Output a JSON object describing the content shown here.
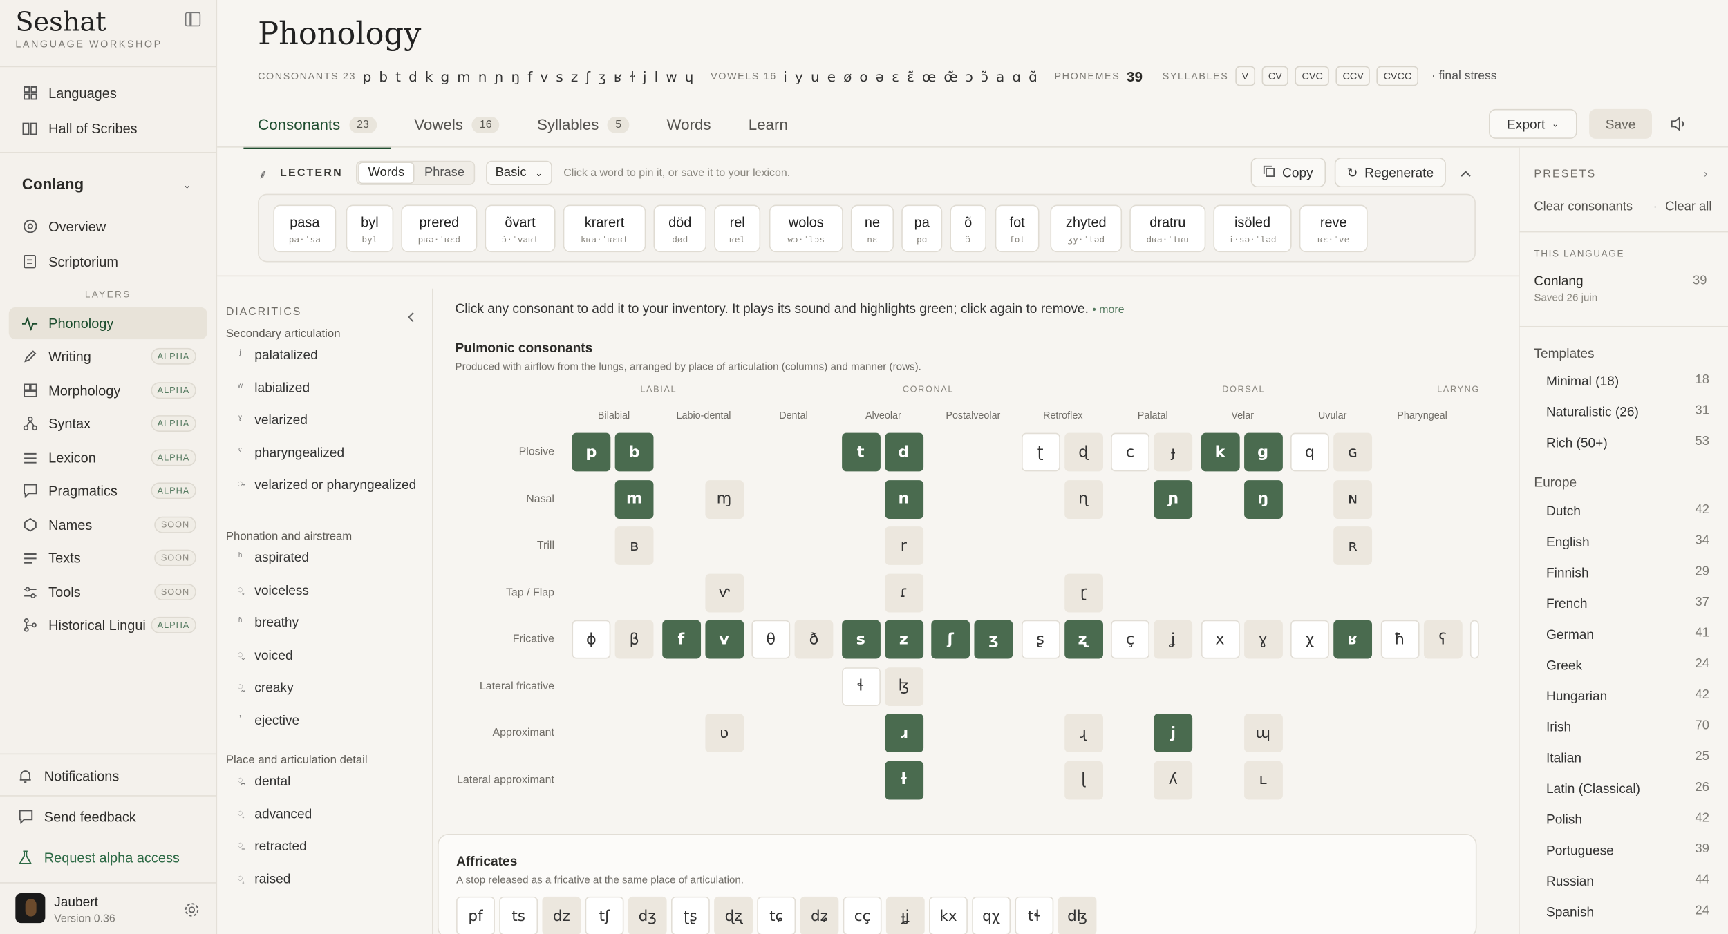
{
  "brand": {
    "name": "Seshat",
    "sub": "LANGUAGE WORKSHOP"
  },
  "nav": {
    "languages": "Languages",
    "hall": "Hall of Scribes",
    "conlang": "Conlang",
    "overview": "Overview",
    "scriptorium": "Scriptorium",
    "layers": "LAYERS",
    "items": [
      {
        "label": "Phonology",
        "badge": ""
      },
      {
        "label": "Writing",
        "badge": "ALPHA"
      },
      {
        "label": "Morphology",
        "badge": "ALPHA"
      },
      {
        "label": "Syntax",
        "badge": "ALPHA"
      },
      {
        "label": "Lexicon",
        "badge": "ALPHA"
      },
      {
        "label": "Pragmatics",
        "badge": "ALPHA"
      },
      {
        "label": "Names",
        "badge": "SOON"
      },
      {
        "label": "Texts",
        "badge": "SOON"
      },
      {
        "label": "Tools",
        "badge": "SOON"
      },
      {
        "label": "Historical Lingui:",
        "badge": "ALPHA"
      }
    ],
    "notifications": "Notifications",
    "feedback": "Send feedback",
    "alpha": "Request alpha access",
    "user": "Jaubert",
    "version": "Version 0.36"
  },
  "header": {
    "title": "Phonology",
    "consonants_label": "CONSONANTS 23",
    "consonants": "p b t d k g m n ɲ ŋ f v s z ʃ ʒ ʁ ɫ j l w ɥ",
    "vowels_label": "VOWELS 16",
    "vowels": "i y u e ø o ə ɛ ɛ̃ œ œ̃ ɔ ɔ̃ a ɑ ɑ̃",
    "phonemes_label": "PHONEMES",
    "phonemes": "39",
    "syllables_label": "SYLLABLES",
    "syllables": [
      "V",
      "CV",
      "CVC",
      "CCV",
      "CVCC"
    ],
    "stress": "· final stress"
  },
  "tabs": [
    {
      "label": "Consonants",
      "count": "23"
    },
    {
      "label": "Vowels",
      "count": "16"
    },
    {
      "label": "Syllables",
      "count": "5"
    },
    {
      "label": "Words",
      "count": ""
    },
    {
      "label": "Learn",
      "count": ""
    }
  ],
  "toolbar": {
    "export": "Export",
    "save": "Save"
  },
  "lectern": {
    "label": "LECTERN",
    "mode_words": "Words",
    "mode_phrase": "Phrase",
    "select": "Basic",
    "hint": "Click a word to pin it, or save it to your lexicon.",
    "copy": "Copy",
    "regenerate": "Regenerate",
    "words": [
      {
        "w": "pasa",
        "ipa": "pa·ˈsa"
      },
      {
        "w": "byl",
        "ipa": "byl"
      },
      {
        "w": "prered",
        "ipa": "pʁə·ˈʁɛd"
      },
      {
        "w": "õvart",
        "ipa": "ɔ̃·ˈvaʁt"
      },
      {
        "w": "krarert",
        "ipa": "kʁa·ˈʁɛʁt"
      },
      {
        "w": "död",
        "ipa": "død"
      },
      {
        "w": "rel",
        "ipa": "ʁel"
      },
      {
        "w": "wolos",
        "ipa": "wɔ·ˈlɔs"
      },
      {
        "w": "ne",
        "ipa": "nɛ"
      },
      {
        "w": "pa",
        "ipa": "pɑ"
      },
      {
        "w": "õ",
        "ipa": "ɔ̃"
      },
      {
        "w": "fot",
        "ipa": "fot"
      },
      {
        "w": "zhyted",
        "ipa": "ʒy·ˈtəd"
      },
      {
        "w": "dratru",
        "ipa": "dʁa·ˈtʁu"
      },
      {
        "w": "isöled",
        "ipa": "i·sə·ˈləd"
      },
      {
        "w": "reve",
        "ipa": "ʁɛ·ˈve"
      }
    ]
  },
  "diacritics": {
    "title": "DIACRITICS",
    "groups": [
      {
        "name": "Secondary articulation",
        "items": [
          {
            "m": "ʲ",
            "l": "palatalized"
          },
          {
            "m": "ʷ",
            "l": "labialized"
          },
          {
            "m": "ˠ",
            "l": "velarized"
          },
          {
            "m": "ˤ",
            "l": "pharyngealized"
          },
          {
            "m": "◌̴",
            "l": "velarized or pharyngealized"
          }
        ]
      },
      {
        "name": "Phonation and airstream",
        "items": [
          {
            "m": "ʰ",
            "l": "aspirated"
          },
          {
            "m": "◌̥",
            "l": "voiceless"
          },
          {
            "m": "ʱ",
            "l": "breathy"
          },
          {
            "m": "◌̬",
            "l": "voiced"
          },
          {
            "m": "◌̰",
            "l": "creaky"
          },
          {
            "m": "ʼ",
            "l": "ejective"
          }
        ]
      },
      {
        "name": "Place and articulation detail",
        "items": [
          {
            "m": "◌̪",
            "l": "dental"
          },
          {
            "m": "◌̟",
            "l": "advanced"
          },
          {
            "m": "◌̠",
            "l": "retracted"
          },
          {
            "m": "◌̝",
            "l": "raised"
          }
        ]
      }
    ]
  },
  "chart": {
    "note": "Click any consonant to add it to your inventory. It plays its sound and highlights green; click again to remove.",
    "more": "• more",
    "title": "Pulmonic consonants",
    "sub": "Produced with airflow from the lungs, arranged by place of articulation (columns) and manner (rows).",
    "groups": [
      "LABIAL",
      "CORONAL",
      "DORSAL",
      "LARYNG"
    ],
    "columns": [
      "Bilabial",
      "Labio-dental",
      "Dental",
      "Alveolar",
      "Postalveolar",
      "Retroflex",
      "Palatal",
      "Velar",
      "Uvular",
      "Pharyngeal"
    ],
    "rows": [
      "Plosive",
      "Nasal",
      "Trill",
      "Tap / Flap",
      "Fricative",
      "Lateral fricative",
      "Approximant",
      "Lateral approximant"
    ]
  },
  "cells": [
    {
      "s": "p",
      "r": 0,
      "c": 0,
      "v": 0,
      "st": "on"
    },
    {
      "s": "b",
      "r": 0,
      "c": 0,
      "v": 1,
      "st": "on"
    },
    {
      "s": "t",
      "r": 0,
      "c": 3,
      "v": 0,
      "st": "on"
    },
    {
      "s": "d",
      "r": 0,
      "c": 3,
      "v": 1,
      "st": "on"
    },
    {
      "s": "ʈ",
      "r": 0,
      "c": 5,
      "v": 0,
      "st": "off"
    },
    {
      "s": "ɖ",
      "r": 0,
      "c": 5,
      "v": 1,
      "st": "tint"
    },
    {
      "s": "c",
      "r": 0,
      "c": 6,
      "v": 0,
      "st": "off"
    },
    {
      "s": "ɟ",
      "r": 0,
      "c": 6,
      "v": 1,
      "st": "tint"
    },
    {
      "s": "k",
      "r": 0,
      "c": 7,
      "v": 0,
      "st": "on"
    },
    {
      "s": "g",
      "r": 0,
      "c": 7,
      "v": 1,
      "st": "on"
    },
    {
      "s": "q",
      "r": 0,
      "c": 8,
      "v": 0,
      "st": "off"
    },
    {
      "s": "ɢ",
      "r": 0,
      "c": 8,
      "v": 1,
      "st": "tint"
    },
    {
      "s": "m",
      "r": 1,
      "c": 0,
      "v": 1,
      "st": "on"
    },
    {
      "s": "ɱ",
      "r": 1,
      "c": 1,
      "v": 1,
      "st": "tint"
    },
    {
      "s": "n",
      "r": 1,
      "c": 3,
      "v": 1,
      "st": "on"
    },
    {
      "s": "ɳ",
      "r": 1,
      "c": 5,
      "v": 1,
      "st": "tint"
    },
    {
      "s": "ɲ",
      "r": 1,
      "c": 6,
      "v": 1,
      "st": "on"
    },
    {
      "s": "ŋ",
      "r": 1,
      "c": 7,
      "v": 1,
      "st": "on"
    },
    {
      "s": "ɴ",
      "r": 1,
      "c": 8,
      "v": 1,
      "st": "tint"
    },
    {
      "s": "ʙ",
      "r": 2,
      "c": 0,
      "v": 1,
      "st": "tint"
    },
    {
      "s": "r",
      "r": 2,
      "c": 3,
      "v": 1,
      "st": "tint"
    },
    {
      "s": "ʀ",
      "r": 2,
      "c": 8,
      "v": 1,
      "st": "tint"
    },
    {
      "s": "ⱱ",
      "r": 3,
      "c": 1,
      "v": 1,
      "st": "tint"
    },
    {
      "s": "ɾ",
      "r": 3,
      "c": 3,
      "v": 1,
      "st": "tint"
    },
    {
      "s": "ɽ",
      "r": 3,
      "c": 5,
      "v": 1,
      "st": "tint"
    },
    {
      "s": "ɸ",
      "r": 4,
      "c": 0,
      "v": 0,
      "st": "off"
    },
    {
      "s": "β",
      "r": 4,
      "c": 0,
      "v": 1,
      "st": "tint"
    },
    {
      "s": "f",
      "r": 4,
      "c": 1,
      "v": 0,
      "st": "on"
    },
    {
      "s": "v",
      "r": 4,
      "c": 1,
      "v": 1,
      "st": "on"
    },
    {
      "s": "θ",
      "r": 4,
      "c": 2,
      "v": 0,
      "st": "off"
    },
    {
      "s": "ð",
      "r": 4,
      "c": 2,
      "v": 1,
      "st": "tint"
    },
    {
      "s": "s",
      "r": 4,
      "c": 3,
      "v": 0,
      "st": "on"
    },
    {
      "s": "z",
      "r": 4,
      "c": 3,
      "v": 1,
      "st": "on"
    },
    {
      "s": "ʃ",
      "r": 4,
      "c": 4,
      "v": 0,
      "st": "on"
    },
    {
      "s": "ʒ",
      "r": 4,
      "c": 4,
      "v": 1,
      "st": "on"
    },
    {
      "s": "ʂ",
      "r": 4,
      "c": 5,
      "v": 0,
      "st": "off"
    },
    {
      "s": "ʐ",
      "r": 4,
      "c": 5,
      "v": 1,
      "st": "on"
    },
    {
      "s": "ç",
      "r": 4,
      "c": 6,
      "v": 0,
      "st": "off"
    },
    {
      "s": "ʝ",
      "r": 4,
      "c": 6,
      "v": 1,
      "st": "tint"
    },
    {
      "s": "x",
      "r": 4,
      "c": 7,
      "v": 0,
      "st": "off"
    },
    {
      "s": "ɣ",
      "r": 4,
      "c": 7,
      "v": 1,
      "st": "tint"
    },
    {
      "s": "χ",
      "r": 4,
      "c": 8,
      "v": 0,
      "st": "off"
    },
    {
      "s": "ʁ",
      "r": 4,
      "c": 8,
      "v": 1,
      "st": "on"
    },
    {
      "s": "ħ",
      "r": 4,
      "c": 9,
      "v": 0,
      "st": "off"
    },
    {
      "s": "ʕ",
      "r": 4,
      "c": 9,
      "v": 1,
      "st": "tint"
    },
    {
      "s": "ɬ",
      "r": 5,
      "c": 3,
      "v": 0,
      "st": "off"
    },
    {
      "s": "ɮ",
      "r": 5,
      "c": 3,
      "v": 1,
      "st": "tint"
    },
    {
      "s": "ʋ",
      "r": 6,
      "c": 1,
      "v": 1,
      "st": "tint"
    },
    {
      "s": "ɹ",
      "r": 6,
      "c": 3,
      "v": 1,
      "st": "on"
    },
    {
      "s": "ɻ",
      "r": 6,
      "c": 5,
      "v": 1,
      "st": "tint"
    },
    {
      "s": "j",
      "r": 6,
      "c": 6,
      "v": 1,
      "st": "on"
    },
    {
      "s": "ɰ",
      "r": 6,
      "c": 7,
      "v": 1,
      "st": "tint"
    },
    {
      "s": "ɫ",
      "r": 7,
      "c": 3,
      "v": 1,
      "st": "on"
    },
    {
      "s": "ɭ",
      "r": 7,
      "c": 5,
      "v": 1,
      "st": "tint"
    },
    {
      "s": "ʎ",
      "r": 7,
      "c": 6,
      "v": 1,
      "st": "tint"
    },
    {
      "s": "ʟ",
      "r": 7,
      "c": 7,
      "v": 1,
      "st": "tint"
    }
  ],
  "affricates": {
    "title": "Affricates",
    "sub": "A stop released as a fricative at the same place of articulation.",
    "items": [
      {
        "s": "pf",
        "st": "off"
      },
      {
        "s": "ts",
        "st": "off"
      },
      {
        "s": "dz",
        "st": "tint"
      },
      {
        "s": "tʃ",
        "st": "off"
      },
      {
        "s": "dʒ",
        "st": "tint"
      },
      {
        "s": "ʈʂ",
        "st": "off"
      },
      {
        "s": "ɖʐ",
        "st": "tint"
      },
      {
        "s": "tɕ",
        "st": "off"
      },
      {
        "s": "dʑ",
        "st": "tint"
      },
      {
        "s": "cç",
        "st": "off"
      },
      {
        "s": "ɟʝ",
        "st": "tint"
      },
      {
        "s": "kx",
        "st": "off"
      },
      {
        "s": "qχ",
        "st": "off"
      },
      {
        "s": "tɬ",
        "st": "off"
      },
      {
        "s": "dɮ",
        "st": "tint"
      }
    ]
  },
  "presets": {
    "title": "PRESETS",
    "clear_consonants": "Clear consonants",
    "clear_all": "Clear all",
    "this_language": "THIS LANGUAGE",
    "lang_name": "Conlang",
    "lang_count": "39",
    "saved": "Saved 26 juin",
    "templates_title": "Templates",
    "templates": [
      {
        "n": "Minimal (18)",
        "c": "18"
      },
      {
        "n": "Naturalistic (26)",
        "c": "31"
      },
      {
        "n": "Rich (50+)",
        "c": "53"
      }
    ],
    "europe_title": "Europe",
    "europe": [
      {
        "n": "Dutch",
        "c": "42"
      },
      {
        "n": "English",
        "c": "34"
      },
      {
        "n": "Finnish",
        "c": "29"
      },
      {
        "n": "French",
        "c": "37"
      },
      {
        "n": "German",
        "c": "41"
      },
      {
        "n": "Greek",
        "c": "24"
      },
      {
        "n": "Hungarian",
        "c": "42"
      },
      {
        "n": "Irish",
        "c": "70"
      },
      {
        "n": "Italian",
        "c": "25"
      },
      {
        "n": "Latin (Classical)",
        "c": "26"
      },
      {
        "n": "Polish",
        "c": "42"
      },
      {
        "n": "Portuguese",
        "c": "39"
      },
      {
        "n": "Russian",
        "c": "44"
      },
      {
        "n": "Spanish",
        "c": "24"
      }
    ]
  },
  "colors": {
    "accent": "#4a6b4f",
    "tint": "#ece7de"
  }
}
